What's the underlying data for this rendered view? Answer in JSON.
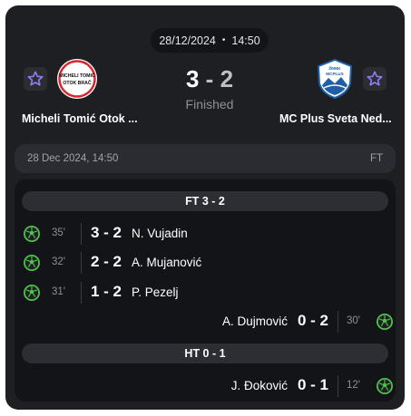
{
  "header": {
    "date": "28/12/2024",
    "time": "14:50",
    "separator": "•"
  },
  "home": {
    "name": "Micheli Tomić Otok ...",
    "crest_text": [
      "MICHELI TOMIĆ",
      "OTOK BRAČ"
    ],
    "score": "3"
  },
  "away": {
    "name": "MC Plus Sveta Ned...",
    "crest_text": [
      "ŽMNK",
      "MCPLUS"
    ],
    "score": "2"
  },
  "score_separator": "-",
  "status": "Finished",
  "info_bar": {
    "datetime": "28 Dec 2024, 14:50",
    "code": "FT"
  },
  "periods": [
    {
      "label": "FT 3 - 2"
    },
    {
      "label": "HT 0 - 1"
    }
  ],
  "events": [
    {
      "side": "home",
      "minute": "35'",
      "score": "3 - 2",
      "player": "N. Vujadin"
    },
    {
      "side": "home",
      "minute": "32'",
      "score": "2 - 2",
      "player": "A. Mujanović"
    },
    {
      "side": "home",
      "minute": "31'",
      "score": "1 - 2",
      "player": "P. Pezelj"
    },
    {
      "side": "away",
      "minute": "30'",
      "score": "0 - 2",
      "player": "A. Dujmović"
    },
    {
      "side": "away",
      "minute": "12'",
      "score": "0 - 1",
      "player": "J. Đoković"
    }
  ],
  "colors": {
    "card": "#1e1f23",
    "goal_icon": "#4ec24a",
    "star": "#8b7cf0"
  },
  "icons": {
    "favorite": "star-outline-icon",
    "goal": "football-icon"
  }
}
